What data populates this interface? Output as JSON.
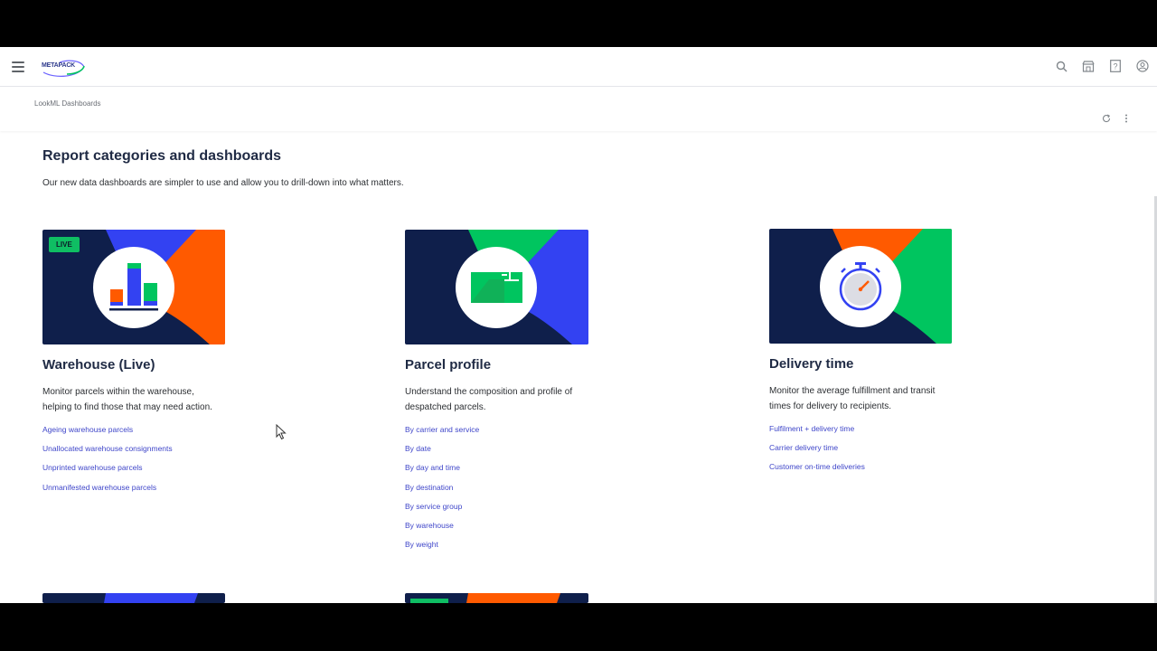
{
  "header": {
    "logo_text": "METAPACK",
    "icons": [
      "search-icon",
      "marketplace-icon",
      "help-icon",
      "account-icon"
    ]
  },
  "subbar": {
    "breadcrumb": "LookML Dashboards",
    "actions": [
      "reload-icon",
      "more-options-icon"
    ]
  },
  "main": {
    "title": "Report categories and dashboards",
    "intro": "Our new data dashboards are simpler to use and allow you to drill-down into what matters."
  },
  "cards": [
    {
      "badge": "LIVE",
      "title": "Warehouse (Live)",
      "description": "Monitor parcels within the warehouse, helping to find those that may need action.",
      "links": [
        "Ageing warehouse parcels",
        "Unallocated warehouse consignments",
        "Unprinted warehouse parcels",
        "Unmanifested warehouse parcels"
      ]
    },
    {
      "title": "Parcel profile",
      "description": "Understand the composition and profile of despatched parcels.",
      "links": [
        "By carrier and service",
        "By date",
        "By day and time",
        "By destination",
        "By service group",
        "By warehouse",
        "By weight"
      ]
    },
    {
      "title": "Delivery time",
      "description": "Monitor the average fulfillment and transit times for delivery to recipients.",
      "links": [
        "Fulfilment + delivery time",
        "Carrier delivery time",
        "Customer on-time deliveries"
      ]
    }
  ],
  "colors": {
    "navy": "#0f1f4b",
    "orange": "#ff5a00",
    "blue": "#3342f2",
    "green": "#00c55f",
    "link": "#3f46c9"
  }
}
